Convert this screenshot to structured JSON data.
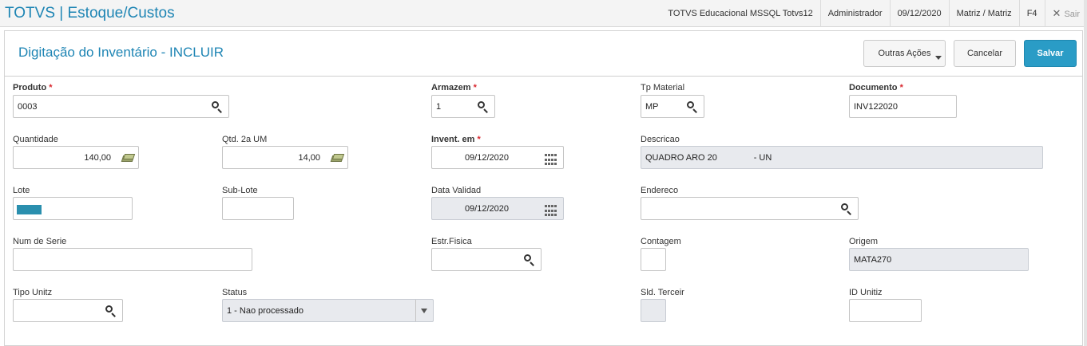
{
  "header": {
    "app_title": "TOTVS | Estoque/Custos",
    "environment": "TOTVS Educacional MSSQL Totvs12",
    "user": "Administrador",
    "date": "09/12/2020",
    "branch": "Matriz / Matriz",
    "shortcut": "F4",
    "exit_label": "Sair"
  },
  "dialog": {
    "title": "Digitação do Inventário - INCLUIR",
    "other_actions_label": "Outras Ações",
    "cancel_label": "Cancelar",
    "save_label": "Salvar"
  },
  "form": {
    "produto": {
      "label": "Produto",
      "required": "*",
      "value": "0003"
    },
    "armazem": {
      "label": "Armazem",
      "required": "*",
      "value": "1"
    },
    "tp_material": {
      "label": "Tp Material",
      "value": "MP"
    },
    "documento": {
      "label": "Documento",
      "required": "*",
      "value": "INV122020"
    },
    "quantidade": {
      "label": "Quantidade",
      "value": "140,00"
    },
    "qtd_2a_um": {
      "label": "Qtd. 2a UM",
      "value": "14,00"
    },
    "invent_em": {
      "label": "Invent. em",
      "required": "*",
      "value": "09/12/2020"
    },
    "descricao": {
      "label": "Descricao",
      "value": "QUADRO ARO 20               - UN"
    },
    "lote": {
      "label": "Lote",
      "value": ""
    },
    "sub_lote": {
      "label": "Sub-Lote",
      "value": ""
    },
    "data_validad": {
      "label": "Data Validad",
      "value": "09/12/2020"
    },
    "endereco": {
      "label": "Endereco",
      "value": ""
    },
    "num_serie": {
      "label": "Num de Serie",
      "value": ""
    },
    "estr_fisica": {
      "label": "Estr.Fisica",
      "value": ""
    },
    "contagem": {
      "label": "Contagem",
      "value": ""
    },
    "origem": {
      "label": "Origem",
      "value": "MATA270"
    },
    "tipo_unitz": {
      "label": "Tipo Unitz",
      "value": ""
    },
    "status": {
      "label": "Status",
      "value": "1 - Nao processado"
    },
    "sld_terceir": {
      "label": "Sld. Terceir",
      "value": ""
    },
    "id_unitiz": {
      "label": "ID Unitiz",
      "value": ""
    }
  },
  "colors": {
    "accent": "#1e85b4",
    "primary_button": "#2a9cc6",
    "required": "#d9272e",
    "readonly_bg": "#e8eaee"
  }
}
